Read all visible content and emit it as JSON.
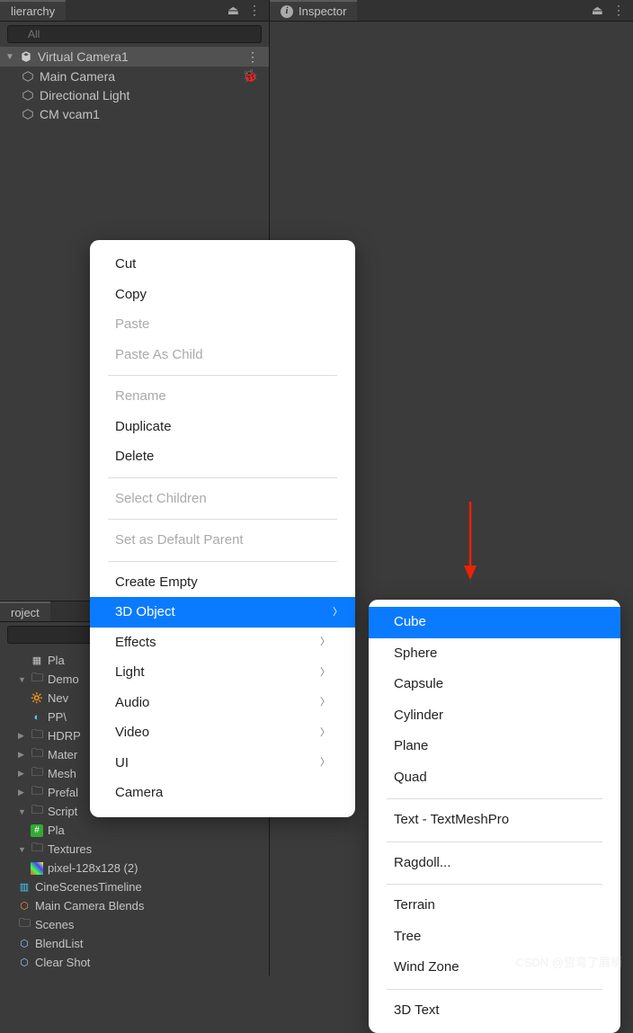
{
  "hierarchy": {
    "tab_label": "lierarchy",
    "search_placeholder": "All",
    "scene_name": "Virtual Camera1",
    "objects": [
      "Main Camera",
      "Directional Light",
      "CM vcam1"
    ]
  },
  "inspector": {
    "tab_label": "Inspector"
  },
  "project": {
    "tab_label": "roject",
    "tree": {
      "r0": "Pla",
      "r1": "Demo",
      "r2": "Nev",
      "r3": "PP\\",
      "r4": "HDRP",
      "r5": "Mater",
      "r6": "Mesh",
      "r7": "Prefal",
      "r8": "Script",
      "r9": "Pla",
      "r10": "Textures",
      "r11": "pixel-128x128 (2)",
      "r12": "CineScenesTimeline",
      "r13": "Main Camera Blends",
      "r14": "Scenes",
      "r15": "BlendList",
      "r16": "Clear Shot"
    }
  },
  "context_menu": {
    "items": {
      "cut": "Cut",
      "copy": "Copy",
      "paste": "Paste",
      "paste_child": "Paste As Child",
      "rename": "Rename",
      "duplicate": "Duplicate",
      "delete": "Delete",
      "select_children": "Select Children",
      "set_default_parent": "Set as Default Parent",
      "create_empty": "Create Empty",
      "obj3d": "3D Object",
      "effects": "Effects",
      "light": "Light",
      "audio": "Audio",
      "video": "Video",
      "ui": "UI",
      "camera": "Camera"
    },
    "submenu_3d": [
      "Cube",
      "Sphere",
      "Capsule",
      "Cylinder",
      "Plane",
      "Quad",
      "Text - TextMeshPro",
      "Ragdoll...",
      "Terrain",
      "Tree",
      "Wind Zone",
      "3D Text"
    ]
  },
  "watermark": "CSDN @雪弯了眉梢"
}
